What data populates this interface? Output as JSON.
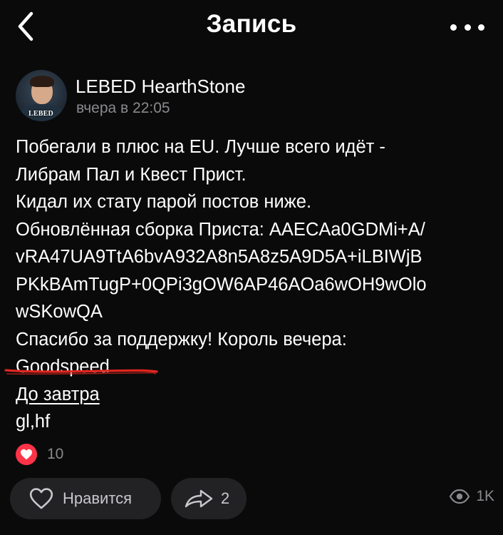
{
  "header": {
    "title": "Запись",
    "back_icon": "chevron-left-icon",
    "more_icon": "more-horizontal-icon"
  },
  "author": {
    "name": "LEBED HearthStone",
    "time": "вчера в 22:05",
    "avatar_badge": "LEBED"
  },
  "post": {
    "lines": [
      "Побегали в плюс на EU. Лучше всего идёт -",
      "Либрам Пал и Квест Прист.",
      "Кидал их стату парой постов ниже.",
      "Обновлённая сборка Приста: AAECAa0GDMi+A/",
      "vRA47UA9TtA6bvA932A8n5A8z5A9D5A+iLBIWjB",
      "PKkBAmTugP+0QPi3gOW6AP46AOa6wOH9wOlo",
      "wSKowQA",
      "Спасибо за поддержку! Король вечера:",
      "Goodspeed",
      "До завтра",
      "gl,hf"
    ],
    "highlight_color": "#e0261f"
  },
  "likes": {
    "count": "10",
    "icon": "heart-filled-icon",
    "badge_color": "#ff3347"
  },
  "actions": {
    "like_label": "Нравится",
    "like_icon": "heart-outline-icon",
    "share_count": "2",
    "share_icon": "share-arrow-icon",
    "views_count": "1K",
    "views_icon": "eye-icon"
  },
  "colors": {
    "background": "#0a0a0a",
    "text": "#ffffff",
    "muted": "#8a8a8e",
    "pill": "#222224"
  }
}
